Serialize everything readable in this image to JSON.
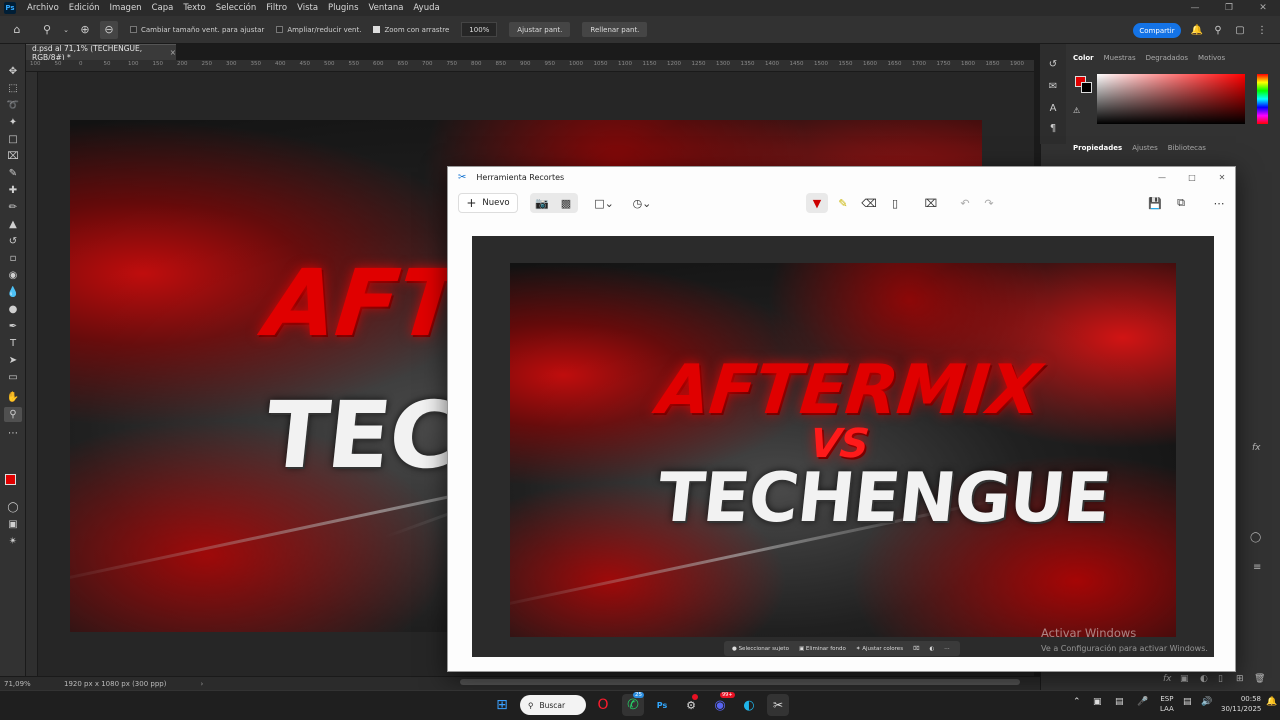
{
  "menubar": {
    "items": [
      "Archivo",
      "Edición",
      "Imagen",
      "Capa",
      "Texto",
      "Selección",
      "Filtro",
      "Vista",
      "Plugins",
      "Ventana",
      "Ayuda"
    ]
  },
  "options": {
    "resize_windows": "Cambiar tamaño vent. para ajustar",
    "zoom_all": "Ampliar/reducir vent.",
    "scrubby_zoom": "Zoom con arrastre",
    "zoom_value": "100%",
    "fit_screen": "Ajustar pant.",
    "fill_screen": "Rellenar pant.",
    "share": "Compartir"
  },
  "document": {
    "tab_title": "d.psd al 71,1% (TECHENGUE, RGB/8#) *",
    "zoom": "71,09%",
    "doc_info": "1920 px x 1080 px (300 ppp)"
  },
  "ruler": {
    "ticks": [
      "100",
      "50",
      "0",
      "50",
      "100",
      "150",
      "200",
      "250",
      "300",
      "350",
      "400",
      "450",
      "500",
      "550",
      "600",
      "650",
      "700",
      "750",
      "800",
      "850",
      "900",
      "950",
      "1000",
      "1050",
      "1100",
      "1150",
      "1200",
      "1250",
      "1300",
      "1350",
      "1400",
      "1450",
      "1500",
      "1550",
      "1600",
      "1650",
      "1700",
      "1750",
      "1800",
      "1850",
      "1900",
      "1950",
      "2000"
    ]
  },
  "panels": {
    "color_tabs": [
      "Color",
      "Muestras",
      "Degradados",
      "Motivos"
    ],
    "prop_tabs": [
      "Propiedades",
      "Ajustes",
      "Bibliotecas"
    ]
  },
  "artwork": {
    "line1": "AFTERMIX",
    "vs": "VS",
    "line2": "TECHENGUE"
  },
  "snip": {
    "title": "Herramienta Recortes",
    "new_label": "Nuevo",
    "actions": [
      "Seleccionar sujeto",
      "Eliminar fondo",
      "Ajustar colores"
    ]
  },
  "taskbar": {
    "search": "Buscar",
    "lang1": "ESP",
    "lang2": "LAA",
    "time": "00:58",
    "date": "30/11/2025",
    "whatsapp_badge": "25",
    "discord_badge": "99+"
  },
  "watermark": {
    "title": "Activar Windows",
    "subtitle": "Ve a Configuración para activar Windows."
  },
  "colors": {
    "foreground": "#e00000",
    "background": "#000000",
    "accent": "#1473e6"
  }
}
